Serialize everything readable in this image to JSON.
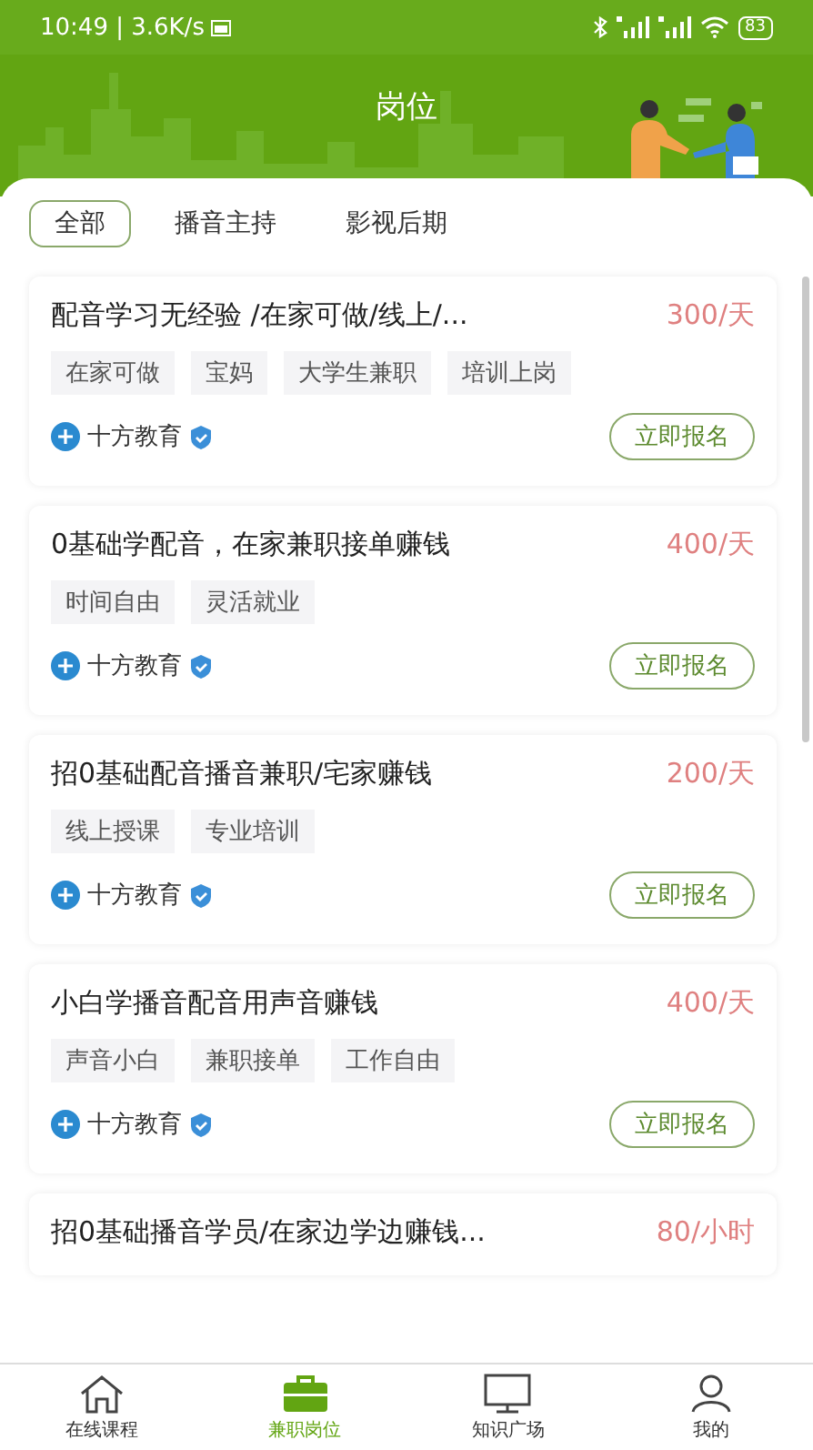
{
  "status_bar": {
    "time": "10:49 | 3.6K/s",
    "battery": "83"
  },
  "header": {
    "title": "岗位"
  },
  "tabs": [
    {
      "label": "全部",
      "selected": true
    },
    {
      "label": "播音主持",
      "selected": false
    },
    {
      "label": "影视后期",
      "selected": false
    }
  ],
  "jobs": [
    {
      "title": "配音学习无经验 /在家可做/线上/...",
      "salary": "300/天",
      "tags": [
        "在家可做",
        "宝妈",
        "大学生兼职",
        "培训上岗"
      ],
      "company": "十方教育",
      "verified": true,
      "action": "立即报名"
    },
    {
      "title": "0基础学配音，在家兼职接单赚钱",
      "salary": "400/天",
      "tags": [
        "时间自由",
        "灵活就业"
      ],
      "company": "十方教育",
      "verified": true,
      "action": "立即报名"
    },
    {
      "title": "招0基础配音播音兼职/宅家赚钱",
      "salary": "200/天",
      "tags": [
        "线上授课",
        "专业培训"
      ],
      "company": "十方教育",
      "verified": true,
      "action": "立即报名"
    },
    {
      "title": "小白学播音配音用声音赚钱",
      "salary": "400/天",
      "tags": [
        "声音小白",
        "兼职接单",
        "工作自由"
      ],
      "company": "十方教育",
      "verified": true,
      "action": "立即报名"
    },
    {
      "title": "招0基础播音学员/在家边学边赚钱...",
      "salary": "80/小时"
    }
  ],
  "bottom_nav": [
    {
      "label": "在线课程",
      "kind": "home",
      "selected": false
    },
    {
      "label": "兼职岗位",
      "kind": "briefcase",
      "selected": true
    },
    {
      "label": "知识广场",
      "kind": "monitor",
      "selected": false
    },
    {
      "label": "我的",
      "kind": "person",
      "selected": false
    }
  ]
}
